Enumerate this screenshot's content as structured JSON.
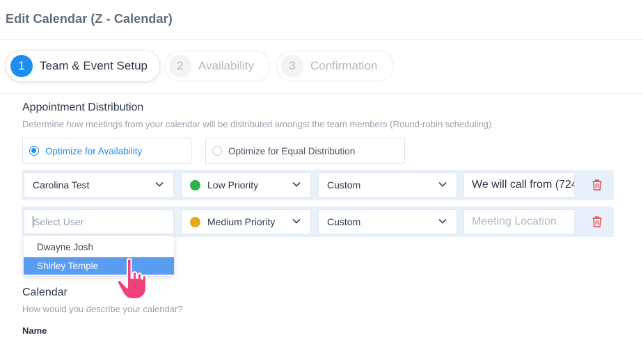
{
  "header": {
    "title": "Edit Calendar (Z - Calendar)"
  },
  "steps": [
    {
      "num": "1",
      "label": "Team & Event Setup",
      "active": true
    },
    {
      "num": "2",
      "label": "Availability",
      "active": false
    },
    {
      "num": "3",
      "label": "Confirmation",
      "active": false
    }
  ],
  "distribution": {
    "title": "Appointment Distribution",
    "subtitle": "Determine how meetings from your calendar will be distributed amongst the team members (Round-robin scheduling)",
    "options": [
      {
        "label": "Optimize for Availability",
        "selected": true
      },
      {
        "label": "Optimize for Equal Distribution",
        "selected": false
      }
    ]
  },
  "members": [
    {
      "user": "Carolina Test",
      "priority": "Low Priority",
      "priority_color": "#2fb34a",
      "location_type": "Custom",
      "location": "We will call from (724"
    },
    {
      "user_placeholder": "Select User",
      "priority": "Medium Priority",
      "priority_color": "#e8a81e",
      "location_type": "Custom",
      "location_placeholder": "Meeting Location"
    }
  ],
  "user_dropdown": {
    "options": [
      "Dwayne Josh",
      "Shirley Temple"
    ],
    "highlighted": "Shirley Temple"
  },
  "calendar": {
    "title": "Calendar",
    "subtitle": "How would you describe your calendar?",
    "name_label": "Name"
  },
  "colors": {
    "accent": "#1d8df0",
    "delete": "#e04b52",
    "row_bg": "#e8f1fb",
    "highlight": "#5a9cf2",
    "pointer": "#f0427a"
  }
}
